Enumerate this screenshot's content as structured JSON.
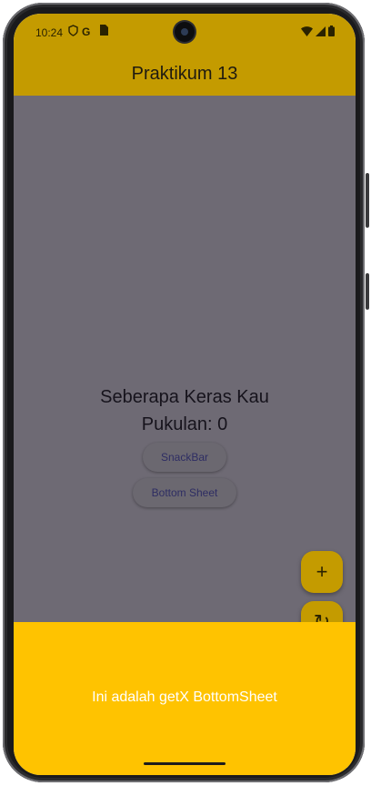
{
  "status_bar": {
    "time": "10:24",
    "left_icons": [
      "shield-icon",
      "google-g-icon",
      "sim-card-icon"
    ],
    "right_icons": [
      "wifi-icon",
      "signal-icon",
      "battery-icon"
    ],
    "google_glyph": "G"
  },
  "app_bar": {
    "title": "Praktikum 13",
    "color": "#c49b00"
  },
  "main": {
    "heading_line1": "Seberapa Keras Kau",
    "heading_line2": "Pukulan: 0",
    "snackbar_button": "SnackBar",
    "bottomsheet_button": "Bottom Sheet"
  },
  "fabs": {
    "add_symbol": "+",
    "refresh_symbol": "↻"
  },
  "bottom_sheet": {
    "text": "Ini adalah getX BottomSheet",
    "color": "#ffc300"
  },
  "colors": {
    "scrim": "#6e6a74",
    "sheet_text": "#ffffff"
  }
}
